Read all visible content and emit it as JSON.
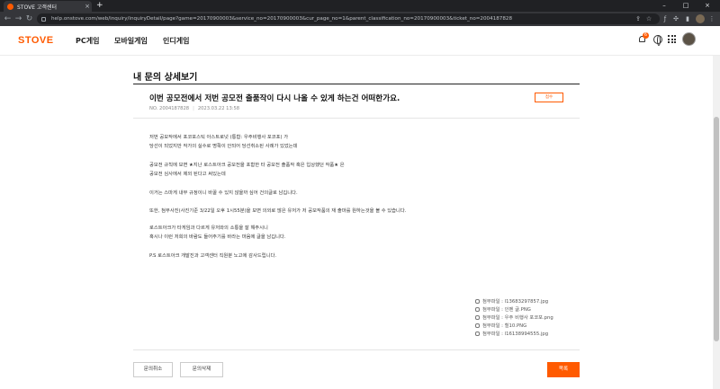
{
  "browser": {
    "tab_title": "STOVE 고객센터",
    "tab_close": "×",
    "new_tab": "+",
    "url": "help.onstove.com/web/inquiry/inquiryDetail/page?game=20170900003&service_no=20170900003&cur_page_no=1&parent_classification_no=20170900003&ticket_no=2004187828",
    "back": "←",
    "forward": "→",
    "reload": "↻",
    "minimize": "–",
    "maximize": "□",
    "close": "×"
  },
  "site": {
    "logo": "STOVE",
    "nav": [
      "PC게임",
      "모바일게임",
      "인디게임"
    ],
    "notification_count": "6"
  },
  "page": {
    "title": "내 문의 상세보기"
  },
  "inquiry": {
    "title": "이번 공모전에서 저번 공모전 출품작이 다시 나올 수 있게 하는건 어떠한가요.",
    "status": "접수",
    "number": "NO. 2004187828",
    "date": "2023.03.22 13:58",
    "body": [
      "저번 공모작에서 포코포스틱 아스트로넛 (통합: 우주비행사 포코포) 가",
      "당선이 되었지만 작가의 실수로 명확이 안되어 당선취소된 사례가 있었는데",
      "공모전 규칙에 보면 ★지난 로스트아크 공모전을 포함한 타 공모전 출품작 혹은 입상했던 작품★ 은",
      "공모전 심사에서 제외 된다고 써있는데",
      "이거는 스마게 내부 규정이니 바꿀 수 있지 않을까 싶어 건의글로 남깁니다.",
      "또한, 첨부사진(사진기준 3/22일 오후 1시55분)을 보면 의외로 많은 유저가 저 공모작품의 재 출마를 원하는것을 볼 수 있습니다.",
      "로스트아크가 타게임과 다르게 유저와의 소통을 잘 해주시니",
      "혹시나 이런 저희의 바람도 들어주기를 바라는 마음에 글을 남깁니다.",
      "P.S 로스트아크 개발진과 고객센터 직원분 노고에 감사드립니다."
    ],
    "attachments": [
      "첨부파일 : l13683297857.jpg",
      "첨부파일 : 인벤 글.PNG",
      "첨부파일 : 우주 비행사 포코포.png",
      "첨부파일 : 힐10.PNG",
      "첨부파일 : l16138994555.jpg"
    ]
  },
  "actions": {
    "cancel": "문의취소",
    "delete": "문의삭제",
    "list": "목록"
  }
}
